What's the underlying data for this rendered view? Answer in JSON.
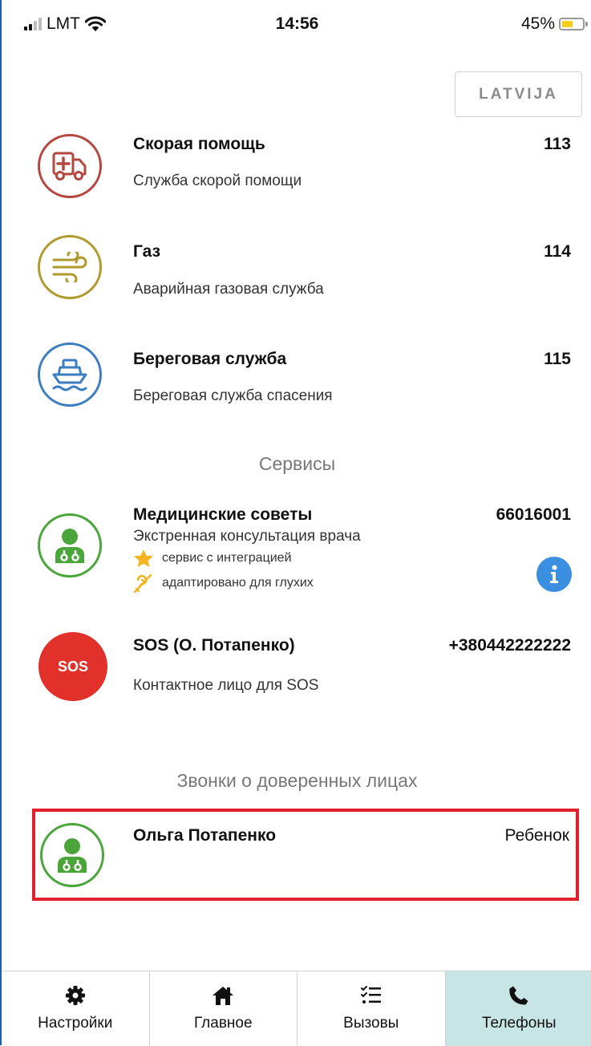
{
  "status_bar": {
    "carrier": "LMT",
    "time": "14:56",
    "battery": "45%",
    "battery_level": 0.45
  },
  "country_button": {
    "label": "LATVIJA"
  },
  "emergency_services": [
    {
      "title": "Скорая помощь",
      "number": "113",
      "description": "Служба скорой помощи",
      "icon": "ambulance-icon",
      "color": "#b4473f"
    },
    {
      "title": "Газ",
      "number": "114",
      "description": "Аварийная газовая служба",
      "icon": "gas-icon",
      "color": "#b09a2c"
    },
    {
      "title": "Береговая служба",
      "number": "115",
      "description": "Береговая служба спасения",
      "icon": "ship-icon",
      "color": "#3d7ec0"
    }
  ],
  "services_section": {
    "title": "Сервисы",
    "items": [
      {
        "title": "Медицинские советы",
        "number": "66016001",
        "description": "Экстренная консультация врача",
        "features": [
          "сервис с интеграцией",
          "адаптировано для глухих"
        ],
        "icon": "doctor-icon",
        "color": "#4aa53a"
      },
      {
        "title": "SOS (О. Потапенко)",
        "number": "+380442222222",
        "description": "Контактное лицо для SOS",
        "icon_text": "SOS",
        "color": "#e2302a"
      }
    ]
  },
  "trusted_section": {
    "title": "Звонки о доверенных лицах",
    "contacts": [
      {
        "name": "Ольга Потапенко",
        "relation": "Ребенок",
        "icon": "doctor-icon",
        "color": "#4aa53a"
      }
    ]
  },
  "tab_bar": {
    "tabs": [
      {
        "label": "Настройки",
        "icon": "gear-icon",
        "active": false
      },
      {
        "label": "Главное",
        "icon": "home-icon",
        "active": false
      },
      {
        "label": "Вызовы",
        "icon": "checklist-icon",
        "active": false
      },
      {
        "label": "Телефоны",
        "icon": "phone-icon",
        "active": true
      }
    ]
  }
}
